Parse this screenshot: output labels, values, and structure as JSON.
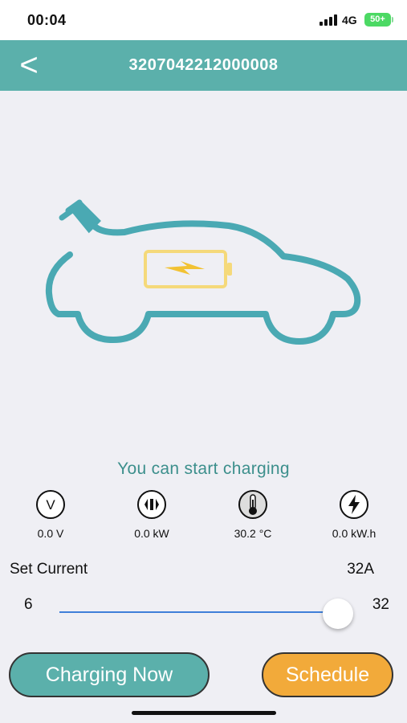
{
  "status_bar": {
    "time": "00:04",
    "network": "4G",
    "battery": "50+",
    "icons": [
      "signal-icon",
      "battery-icon"
    ],
    "battery_color": "#4cd964"
  },
  "header": {
    "back_label": "<",
    "title": "3207042212000008",
    "background_color": "#5bb0ab"
  },
  "illustration": {
    "name": "car-charging-illustration",
    "icons": [
      "plug-icon",
      "car-outline-icon",
      "battery-icon",
      "lightning-icon"
    ],
    "car_color": "#4aa9b3",
    "battery_color": "#f5d97a"
  },
  "status_message": "You can start charging",
  "metrics": [
    {
      "icon": "voltage-icon",
      "value": "0.0 V"
    },
    {
      "icon": "power-icon",
      "value": "0.0 kW"
    },
    {
      "icon": "thermometer-icon",
      "value": "30.2 °C"
    },
    {
      "icon": "energy-icon",
      "value": "0.0 kW.h"
    }
  ],
  "current": {
    "label": "Set Current",
    "value": "32A",
    "min": "6",
    "max": "32",
    "current_level": 32,
    "track_color": "#3f7fd8"
  },
  "buttons": {
    "charge_label": "Charging Now",
    "schedule_label": "Schedule",
    "charge_color": "#5bb0ab",
    "schedule_color": "#f2aa3a"
  }
}
